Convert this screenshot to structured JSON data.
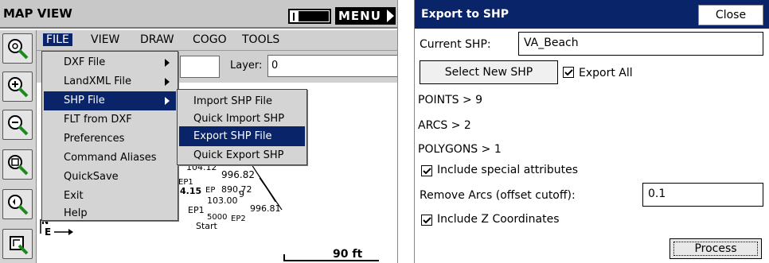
{
  "map_view": {
    "title": "MAP VIEW",
    "menu_button": "MENU",
    "menubar": [
      {
        "label": "FILE",
        "active": true
      },
      {
        "label": "VIEW",
        "active": false
      },
      {
        "label": "DRAW",
        "active": false
      },
      {
        "label": "COGO",
        "active": false
      },
      {
        "label": "TOOLS",
        "active": false
      }
    ],
    "layer_label": "Layer:",
    "layer_value": "0",
    "scale_label": "90 ft",
    "toolbar_icons": [
      "zoom-extents-icon",
      "zoom-in-icon",
      "zoom-out-icon",
      "zoom-window-icon",
      "zoom-previous-icon",
      "pan-icon"
    ],
    "file_menu": [
      {
        "label": "DXF File",
        "has_submenu": true
      },
      {
        "label": "LandXML File",
        "has_submenu": true
      },
      {
        "label": "SHP File",
        "has_submenu": true,
        "selected": true
      },
      {
        "label": "FLT from DXF"
      },
      {
        "label": "Preferences"
      },
      {
        "label": "Command Aliases"
      },
      {
        "label": "QuickSave"
      },
      {
        "label": "Exit"
      },
      {
        "label": "Help"
      }
    ],
    "shp_submenu": [
      {
        "label": "Import SHP File"
      },
      {
        "label": "Quick Import SHP"
      },
      {
        "label": "Export SHP File",
        "selected": true
      },
      {
        "label": "Quick Export SHP"
      }
    ],
    "map_labels": [
      "104.12",
      "996.82",
      "EP1",
      "EP",
      "890.72",
      "4.15",
      "103.00",
      "9",
      "EP1",
      "996.81",
      "5000",
      "EP2",
      "Start",
      "N",
      "E"
    ]
  },
  "export_dialog": {
    "title": "Export to SHP",
    "close_label": "Close",
    "current_shp_label": "Current SHP:",
    "current_shp_value": "VA_Beach",
    "select_new_label": "Select New SHP",
    "export_all_label": "Export All",
    "export_all_checked": true,
    "points_label": "POINTS > 9",
    "arcs_label": "ARCS > 2",
    "polygons_label": "POLYGONS > 1",
    "include_special_label": "Include special attributes",
    "include_special_checked": true,
    "remove_arcs_label": "Remove Arcs (offset cutoff):",
    "remove_arcs_value": "0.1",
    "include_z_label": "Include Z Coordinates",
    "include_z_checked": true,
    "process_label": "Process"
  },
  "colors": {
    "selection_blue": "#0a246a",
    "menu_gray": "#d4d4d4"
  }
}
